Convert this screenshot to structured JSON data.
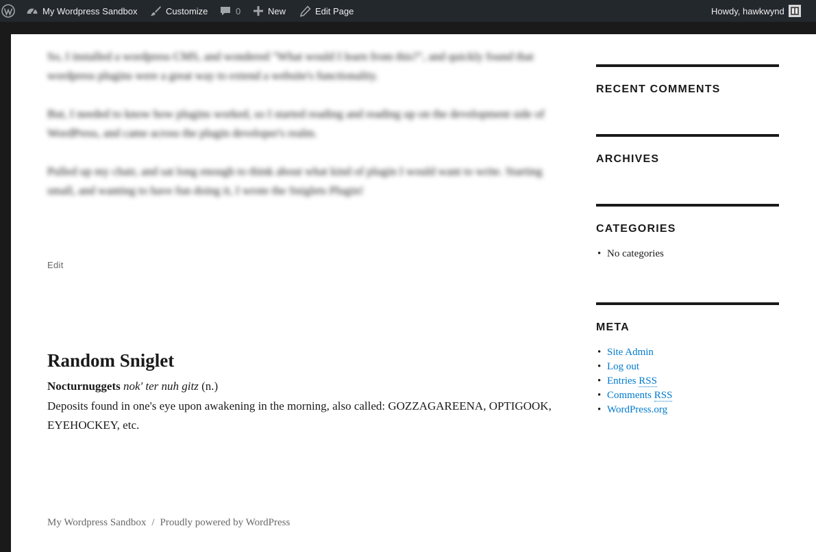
{
  "admin_bar": {
    "site_name": "My Wordpress Sandbox",
    "customize": "Customize",
    "comments_count": "0",
    "new": "New",
    "edit_page": "Edit Page",
    "greeting": "Howdy, hawkwynd"
  },
  "content": {
    "blurred_paragraphs": [
      "So, I installed a wordpress CMS, and wondered \"What would I learn from this?\", and quickly found that wordpress plugins were a great way to extend a website's functionality.",
      "But, I needed to know how plugins worked, so I started reading and reading up on the development side of WordPress, and came across the plugin developer's realm.",
      "Pulled up my chair, and sat long enough to think about what kind of plugin I would want to write. Starting small, and wanting to have fun doing it, I wrote the Sniglets Plugin!"
    ],
    "edit_label": "Edit",
    "sniglet": {
      "title": "Random Sniglet",
      "word": "Nocturnuggets",
      "pronunciation": "nok' ter nuh gitz",
      "part_of_speech": "(n.)",
      "definition": "Deposits found in one's eye upon awakening in the morning, also called: GOZZAGAREENA, OPTIGOOK, EYEHOCKEY, etc."
    }
  },
  "sidebar": {
    "recent_comments_title": "RECENT COMMENTS",
    "archives_title": "ARCHIVES",
    "categories_title": "CATEGORIES",
    "categories_items": [
      "No categories"
    ],
    "meta_title": "META",
    "meta_items": [
      "Site Admin",
      "Log out",
      "Entries",
      "Comments",
      "WordPress.org"
    ],
    "rss_label": "RSS"
  },
  "footer": {
    "site_name": "My Wordpress Sandbox",
    "separator": "/",
    "powered": "Proudly powered by WordPress"
  },
  "colors": {
    "admin_bar_bg": "#23282d",
    "link": "#007acc",
    "text": "#1a1a1a",
    "muted": "#686868"
  }
}
